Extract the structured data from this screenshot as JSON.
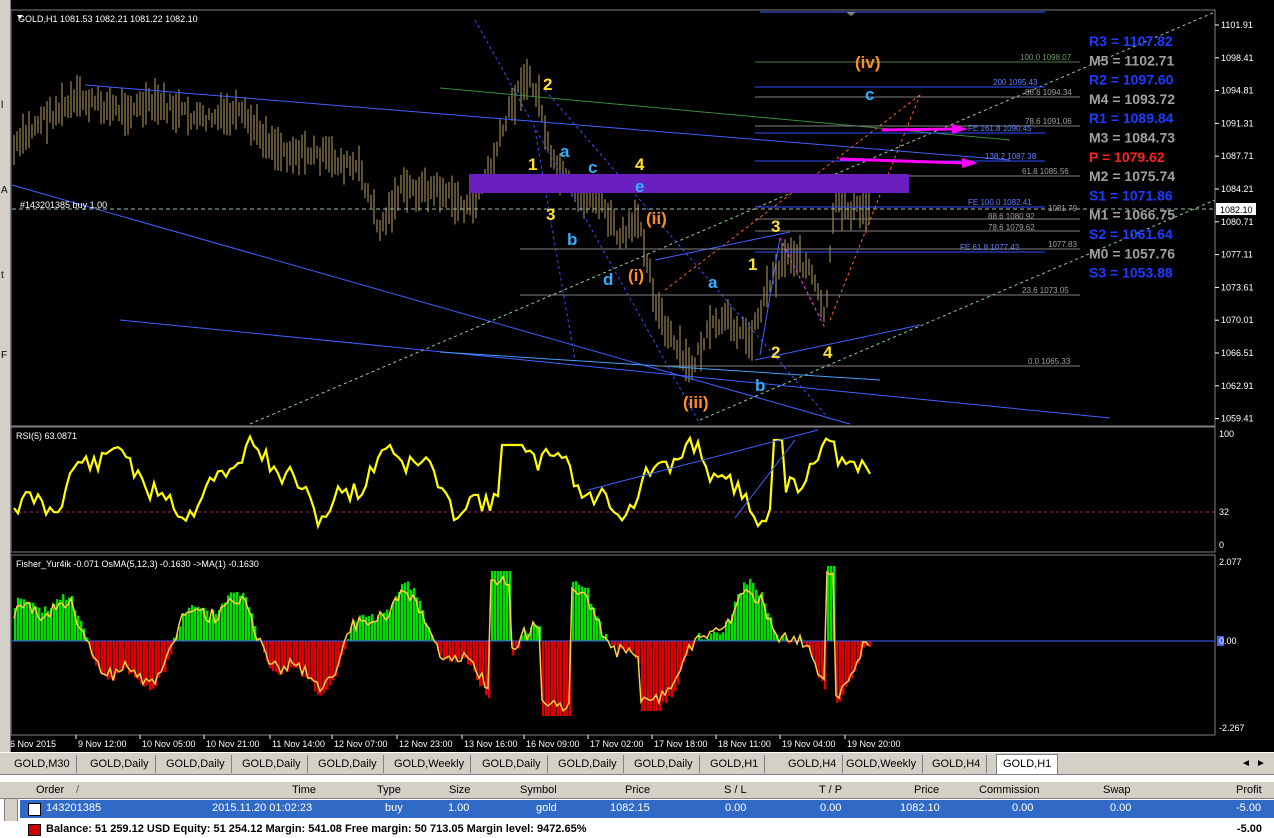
{
  "chart": {
    "symbol_line": "GOLD,H1  1081.53 1082.21 1081.22 1082.10",
    "order_line": "#143201385 buy 1.00",
    "price_ticks": [
      "1101.91",
      "1098.41",
      "1094.81",
      "1091.31",
      "1087.71",
      "1084.21",
      "1080.71",
      "1077.11",
      "1073.61",
      "1070.01",
      "1066.51",
      "1062.91",
      "1059.41"
    ],
    "current_price_label": "1082.10",
    "pivots": [
      {
        "label": "R3 = 1107.82",
        "color": "#1e3cff"
      },
      {
        "label": "M5 = 1102.71",
        "color": "#a0a0a0"
      },
      {
        "label": "R2 = 1097.60",
        "color": "#1e3cff"
      },
      {
        "label": "M4 = 1093.72",
        "color": "#a0a0a0"
      },
      {
        "label": "R1 = 1089.84",
        "color": "#1e3cff"
      },
      {
        "label": "M3 = 1084.73",
        "color": "#a0a0a0"
      },
      {
        "label": "P  = 1079.62",
        "color": "#ff2020"
      },
      {
        "label": "M2 = 1075.74",
        "color": "#a0a0a0"
      },
      {
        "label": "S1 = 1071.86",
        "color": "#1e3cff"
      },
      {
        "label": "M1 = 1066.75",
        "color": "#a0a0a0"
      },
      {
        "label": "S2 = 1061.64",
        "color": "#1e3cff"
      },
      {
        "label": "M0 = 1057.76",
        "color": "#a0a0a0"
      },
      {
        "label": "S3 = 1053.88",
        "color": "#1e3cff"
      }
    ],
    "fib_labels": {
      "f1": "100.0 1098.07",
      "f2": "200 1095.43",
      "f3": "88.6 1094.34",
      "f4": "78.6 1091.06",
      "f5": "FE 161.8 1090.45",
      "f6": "138.2 1087.38",
      "f7": "61.8 1085.56",
      "f8": "FE 100.0 1082.41",
      "f9": "88.6 1080.92",
      "f10": "78.6 1079.62",
      "f11": "FE 61.8 1077.43",
      "f12": "1077.83",
      "f13": "23.6 1073.05",
      "f14": "0.0 1065.33",
      "f15": "1081.79"
    },
    "waves": {
      "y2": "2",
      "y1": "1",
      "y3": "3",
      "y4": "4",
      "ca": "a",
      "cc": "c",
      "cb": "b",
      "cd": "d",
      "ce": "e",
      "oi": "(i)",
      "oii": "(ii)",
      "oiii": "(iii)",
      "oiv": "(iv)",
      "ra": "a",
      "rb": "b",
      "rc": "c",
      "w1": "1",
      "w2": "2",
      "w3": "3",
      "w4": "4"
    }
  },
  "rsi": {
    "title": "RSI(5) 63.0871",
    "ticks": [
      "100",
      "32",
      "0"
    ]
  },
  "fisher": {
    "title": "Fisher_Yur4ik -0.071  OsMA(5,12,3) -0.1630  ->MA(1) -0.1630",
    "ticks": [
      "2.077",
      "0.00",
      "-2.267"
    ]
  },
  "time_axis": [
    "6 Nov 2015",
    "9 Nov 12:00",
    "10 Nov 05:00",
    "10 Nov 21:00",
    "11 Nov 14:00",
    "12 Nov 07:00",
    "12 Nov 23:00",
    "13 Nov 16:00",
    "16 Nov 09:00",
    "17 Nov 02:00",
    "17 Nov 18:00",
    "18 Nov 11:00",
    "19 Nov 04:00",
    "19 Nov 20:00"
  ],
  "tabs": [
    "GOLD,M30",
    "GOLD,Daily",
    "GOLD,Daily",
    "GOLD,Daily",
    "GOLD,Daily",
    "GOLD,Weekly",
    "GOLD,Daily",
    "GOLD,Daily",
    "GOLD,Daily",
    "GOLD,H1",
    "GOLD,H4",
    "GOLD,Weekly",
    "GOLD,H4",
    "GOLD,H1"
  ],
  "active_tab": 13,
  "terminal": {
    "headers": [
      "Order",
      "/",
      "Time",
      "Type",
      "Size",
      "Symbol",
      "Price",
      "S / L",
      "T / P",
      "Price",
      "Commission",
      "Swap",
      "Profit"
    ],
    "order": {
      "id": "143201385",
      "time": "2015.11.20 01:02:23",
      "type": "buy",
      "size": "1.00",
      "symbol": "gold",
      "price": "1082.15",
      "sl": "0.00",
      "tp": "0.00",
      "cur_price": "1082.10",
      "commission": "0.00",
      "swap": "0.00",
      "profit": "-5.00"
    },
    "balance_line": "Balance: 51 259.12 USD  Equity: 51 254.12  Margin: 541.08  Free margin: 50 713.05  Margin level: 9472.65%",
    "balance_profit": "-5.00"
  },
  "colors": {
    "candles": "#b8a060",
    "rsi": "#ffff00",
    "hist_up": "#00e000",
    "hist_down": "#e00000",
    "pivot_blue": "#1e3cff",
    "pivot_gray": "#a0a0a0",
    "pivot_red": "#ff2020",
    "box": "#6a1fc0",
    "arrow": "#ff00ff"
  }
}
